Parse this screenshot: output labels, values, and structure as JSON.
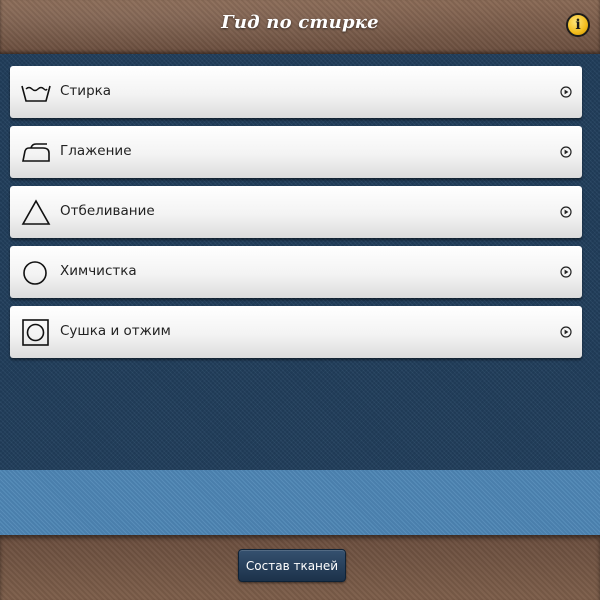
{
  "header": {
    "title": "Гид по стирке"
  },
  "menu": {
    "items": [
      {
        "label": "Стирка",
        "icon": "washtub-icon"
      },
      {
        "label": "Глажение",
        "icon": "iron-icon"
      },
      {
        "label": "Отбеливание",
        "icon": "triangle-icon"
      },
      {
        "label": "Химчистка",
        "icon": "circle-icon"
      },
      {
        "label": "Сушка и отжим",
        "icon": "dryer-square-circle-icon"
      }
    ]
  },
  "footer": {
    "button_label": "Состав тканей"
  }
}
